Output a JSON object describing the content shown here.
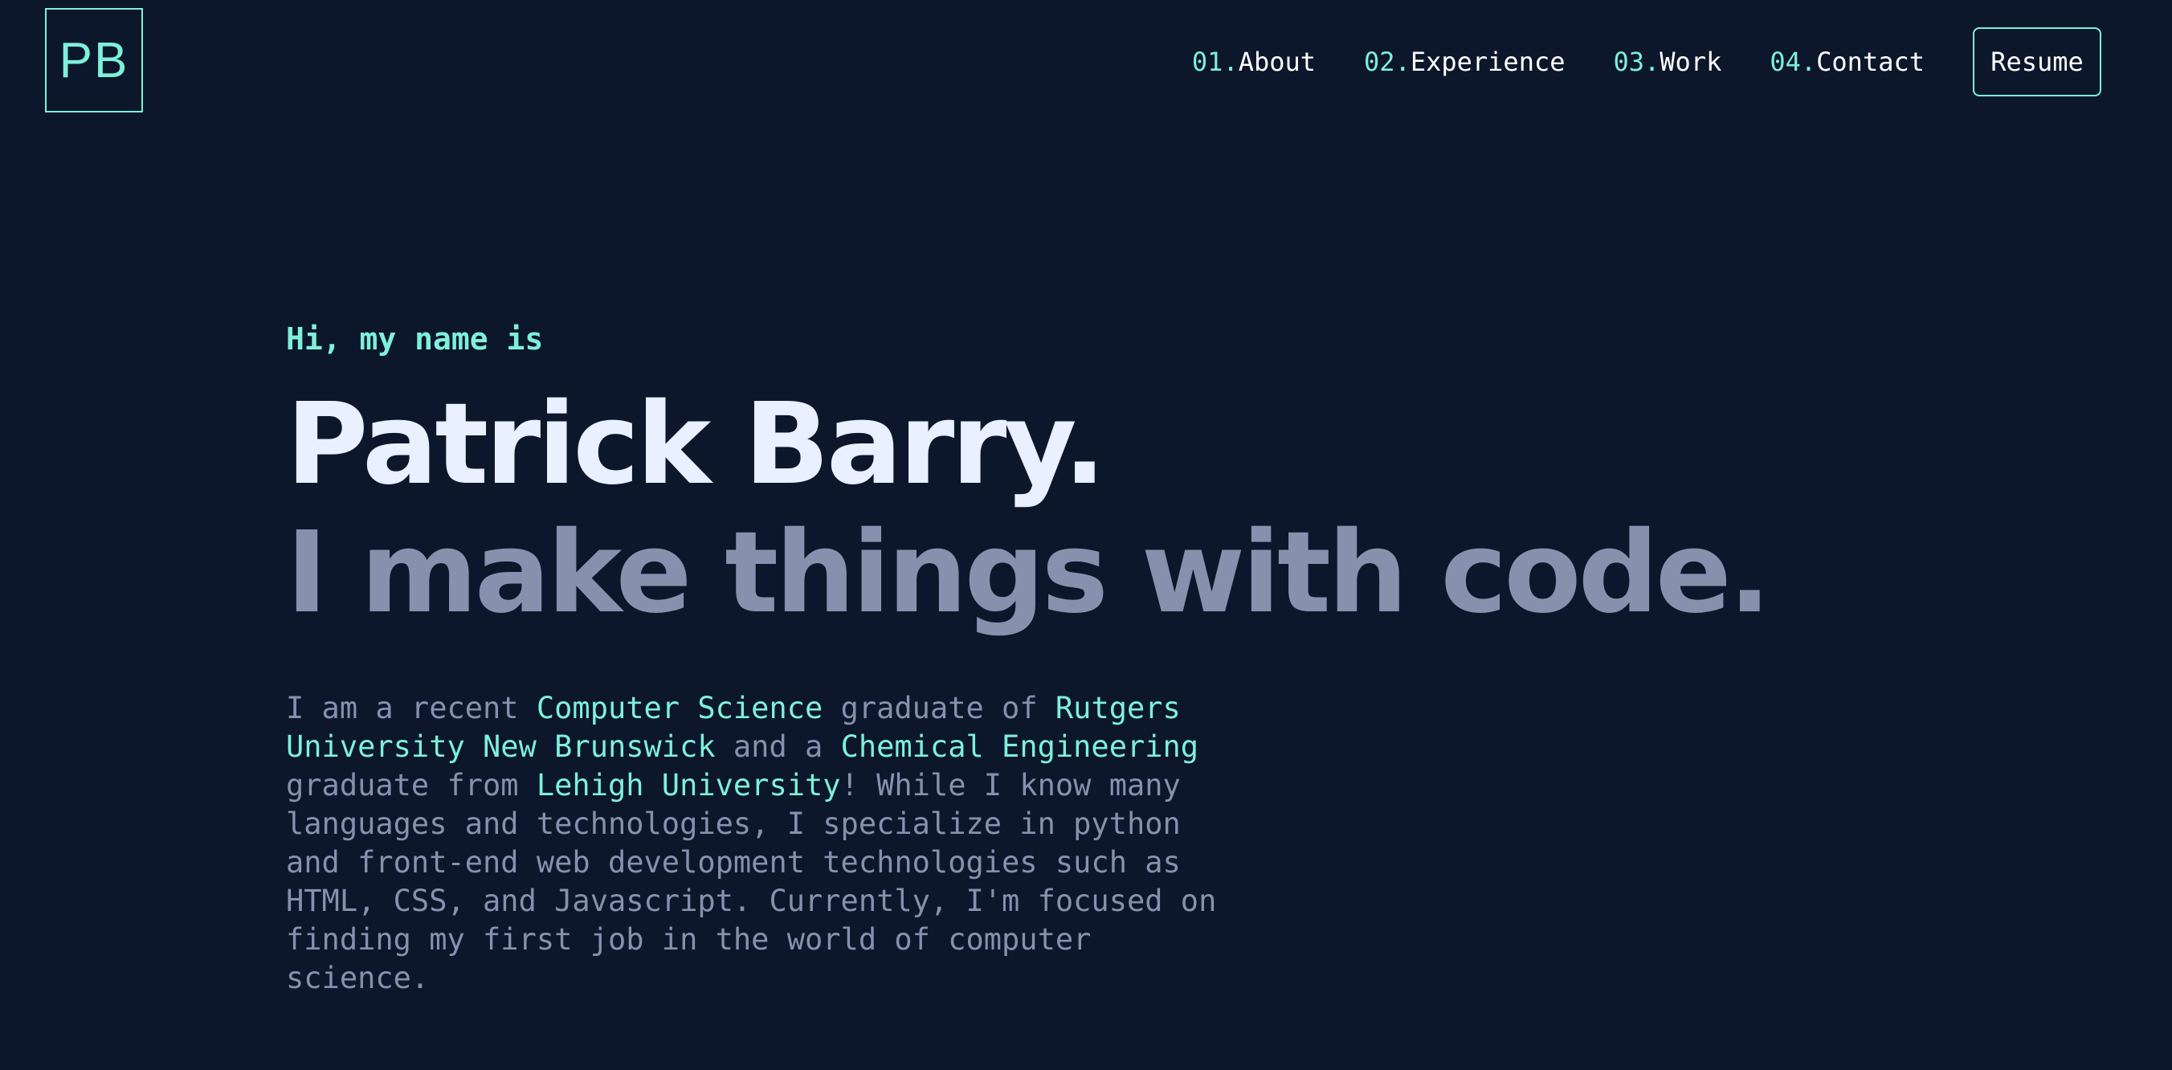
{
  "logo": {
    "text": "PB"
  },
  "nav": {
    "items": [
      {
        "num": "01.",
        "label": "About"
      },
      {
        "num": "02.",
        "label": "Experience"
      },
      {
        "num": "03.",
        "label": "Work"
      },
      {
        "num": "04.",
        "label": "Contact"
      }
    ],
    "resume_label": "Resume"
  },
  "hero": {
    "greeting": "Hi, my name is",
    "name": "Patrick Barry.",
    "tagline": "I make things with code.",
    "bio": {
      "t1": "I am a recent ",
      "h1": "Computer Science",
      "t2": " graduate of ",
      "h2": "Rutgers University New Brunswick",
      "t3": " and a ",
      "h3": "Chemical Engineering",
      "t4": " graduate from ",
      "h4": "Lehigh University",
      "t5": "! While I know many languages and technologies, I specialize in python and front-end web development technologies such as HTML, CSS, and Javascript. Currently, I'm focused on finding my first job in the world of computer science."
    }
  },
  "colors": {
    "background": "#0c172b",
    "accent": "#7ef0da",
    "heading": "#e9f0ff",
    "muted": "#8790ad"
  }
}
